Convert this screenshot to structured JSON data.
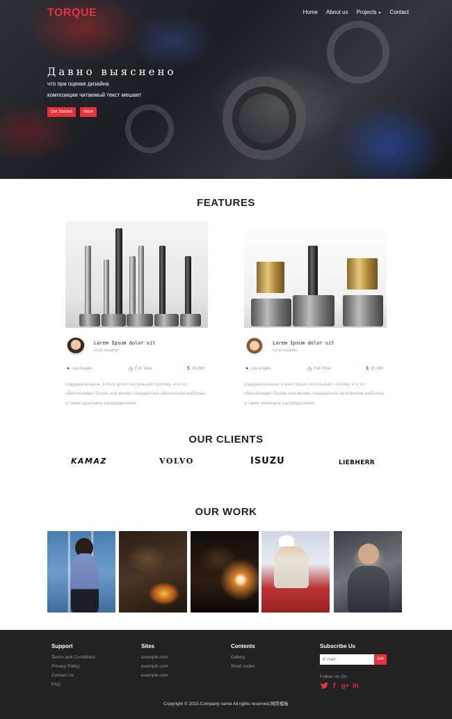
{
  "brand": {
    "name": "TORQUE",
    "color": "#e8323b"
  },
  "nav": {
    "items": [
      "Home",
      "About us",
      "Projects",
      "Contact"
    ],
    "projects_has_dropdown": true
  },
  "hero": {
    "title": "Давно выяснено",
    "subtitle_line1": "что при оценке дизайна",
    "subtitle_line2": "композиции читаемый текст мешает",
    "btn_primary": "Get Started",
    "btn_secondary": "More"
  },
  "features": {
    "title": "FEATURES",
    "cards": [
      {
        "name": "Lorem Ipsum dolor sit",
        "subtitle": "torch weather",
        "location": "Los Angels",
        "job_type": "Full Time",
        "salary": "30,000",
        "description": [
          "содержательное. Lorem Ipsum используют потому, что тот",
          "обеспечивает более или менее стандартное заполнение шаблона,",
          "а также реальное распределение"
        ],
        "icons": {
          "location": "map-pin-icon",
          "time": "clock-icon",
          "salary": "dollar-icon"
        }
      },
      {
        "name": "Lorem Ipsum dolor sit",
        "subtitle": "torch weather",
        "location": "Los Angels",
        "job_type": "Full Time",
        "salary": "30,000",
        "description": [
          "содержательное. Lorem Ipsum используют потому, что тот",
          "обеспечивает более или менее стандартное заполнение шаблона,",
          "а также реальное распределение"
        ],
        "icons": {
          "location": "map-pin-icon",
          "time": "clock-icon",
          "salary": "dollar-icon"
        }
      }
    ]
  },
  "clients": {
    "title": "OUR CLIENTS",
    "logos": [
      "KAMAZ",
      "VOLVO",
      "ISUZU",
      "LIEBHERR"
    ]
  },
  "work": {
    "title": "OUR WORK"
  },
  "footer": {
    "support": {
      "title": "Support",
      "links": [
        "Terms and Conditions",
        "Privacy Policy",
        "Contact Us",
        "FAQ"
      ]
    },
    "sites": {
      "title": "Sites",
      "links": [
        "example.com",
        "example.com",
        "example.com"
      ]
    },
    "contents": {
      "title": "Contents",
      "links": [
        "Gallery",
        "Short codes"
      ]
    },
    "subscribe": {
      "title": "Subscribe Us",
      "placeholder": "E-mail",
      "button": "Join",
      "follow": "Follow Us On",
      "social": [
        "twitter-icon",
        "facebook-icon",
        "google-plus-icon",
        "linkedin-icon"
      ]
    },
    "copyright": "Copyright © 2015.Company name All rights reserved.网页模板"
  }
}
